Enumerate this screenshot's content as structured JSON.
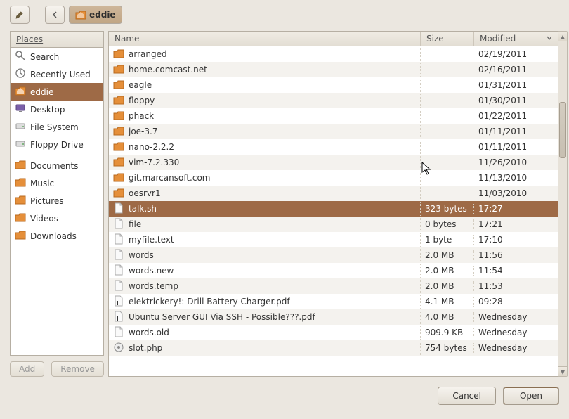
{
  "path": {
    "current": "eddie"
  },
  "sidebar": {
    "header": "Places",
    "items": [
      {
        "label": "Search",
        "icon": "search"
      },
      {
        "label": "Recently Used",
        "icon": "recent"
      },
      {
        "label": "eddie",
        "icon": "home",
        "selected": true
      },
      {
        "label": "Desktop",
        "icon": "desktop"
      },
      {
        "label": "File System",
        "icon": "drive"
      },
      {
        "label": "Floppy Drive",
        "icon": "drive"
      },
      {
        "sep": true
      },
      {
        "label": "Documents",
        "icon": "folder"
      },
      {
        "label": "Music",
        "icon": "folder"
      },
      {
        "label": "Pictures",
        "icon": "folder"
      },
      {
        "label": "Videos",
        "icon": "folder"
      },
      {
        "label": "Downloads",
        "icon": "folder"
      }
    ],
    "add_label": "Add",
    "remove_label": "Remove"
  },
  "columns": {
    "name": "Name",
    "size": "Size",
    "modified": "Modified"
  },
  "files": [
    {
      "name": "arranged",
      "type": "folder",
      "size": "",
      "modified": "02/19/2011"
    },
    {
      "name": "home.comcast.net",
      "type": "folder",
      "size": "",
      "modified": "02/16/2011"
    },
    {
      "name": "eagle",
      "type": "folder",
      "size": "",
      "modified": "01/31/2011"
    },
    {
      "name": "floppy",
      "type": "folder",
      "size": "",
      "modified": "01/30/2011"
    },
    {
      "name": "phack",
      "type": "folder",
      "size": "",
      "modified": "01/22/2011"
    },
    {
      "name": "joe-3.7",
      "type": "folder",
      "size": "",
      "modified": "01/11/2011"
    },
    {
      "name": "nano-2.2.2",
      "type": "folder",
      "size": "",
      "modified": "01/11/2011"
    },
    {
      "name": "vim-7.2.330",
      "type": "folder",
      "size": "",
      "modified": "11/26/2010"
    },
    {
      "name": "git.marcansoft.com",
      "type": "folder",
      "size": "",
      "modified": "11/13/2010"
    },
    {
      "name": "oesrvr1",
      "type": "folder",
      "size": "",
      "modified": "11/03/2010"
    },
    {
      "name": "talk.sh",
      "type": "file",
      "size": "323 bytes",
      "modified": "17:27",
      "selected": true
    },
    {
      "name": "file",
      "type": "file",
      "size": "0 bytes",
      "modified": "17:21"
    },
    {
      "name": "myfile.text",
      "type": "file",
      "size": "1 byte",
      "modified": "17:10"
    },
    {
      "name": "words",
      "type": "file",
      "size": "2.0 MB",
      "modified": "11:56"
    },
    {
      "name": "words.new",
      "type": "file",
      "size": "2.0 MB",
      "modified": "11:54"
    },
    {
      "name": "words.temp",
      "type": "file",
      "size": "2.0 MB",
      "modified": "11:53"
    },
    {
      "name": "elektrickery!: Drill Battery Charger.pdf",
      "type": "pdf",
      "size": "4.1 MB",
      "modified": "09:28"
    },
    {
      "name": "Ubuntu Server GUI Via SSH - Possible???.pdf",
      "type": "pdf",
      "size": "4.0 MB",
      "modified": "Wednesday"
    },
    {
      "name": "words.old",
      "type": "file",
      "size": "909.9 KB",
      "modified": "Wednesday"
    },
    {
      "name": "slot.php",
      "type": "php",
      "size": "754 bytes",
      "modified": "Wednesday"
    }
  ],
  "buttons": {
    "cancel": "Cancel",
    "open": "Open"
  }
}
